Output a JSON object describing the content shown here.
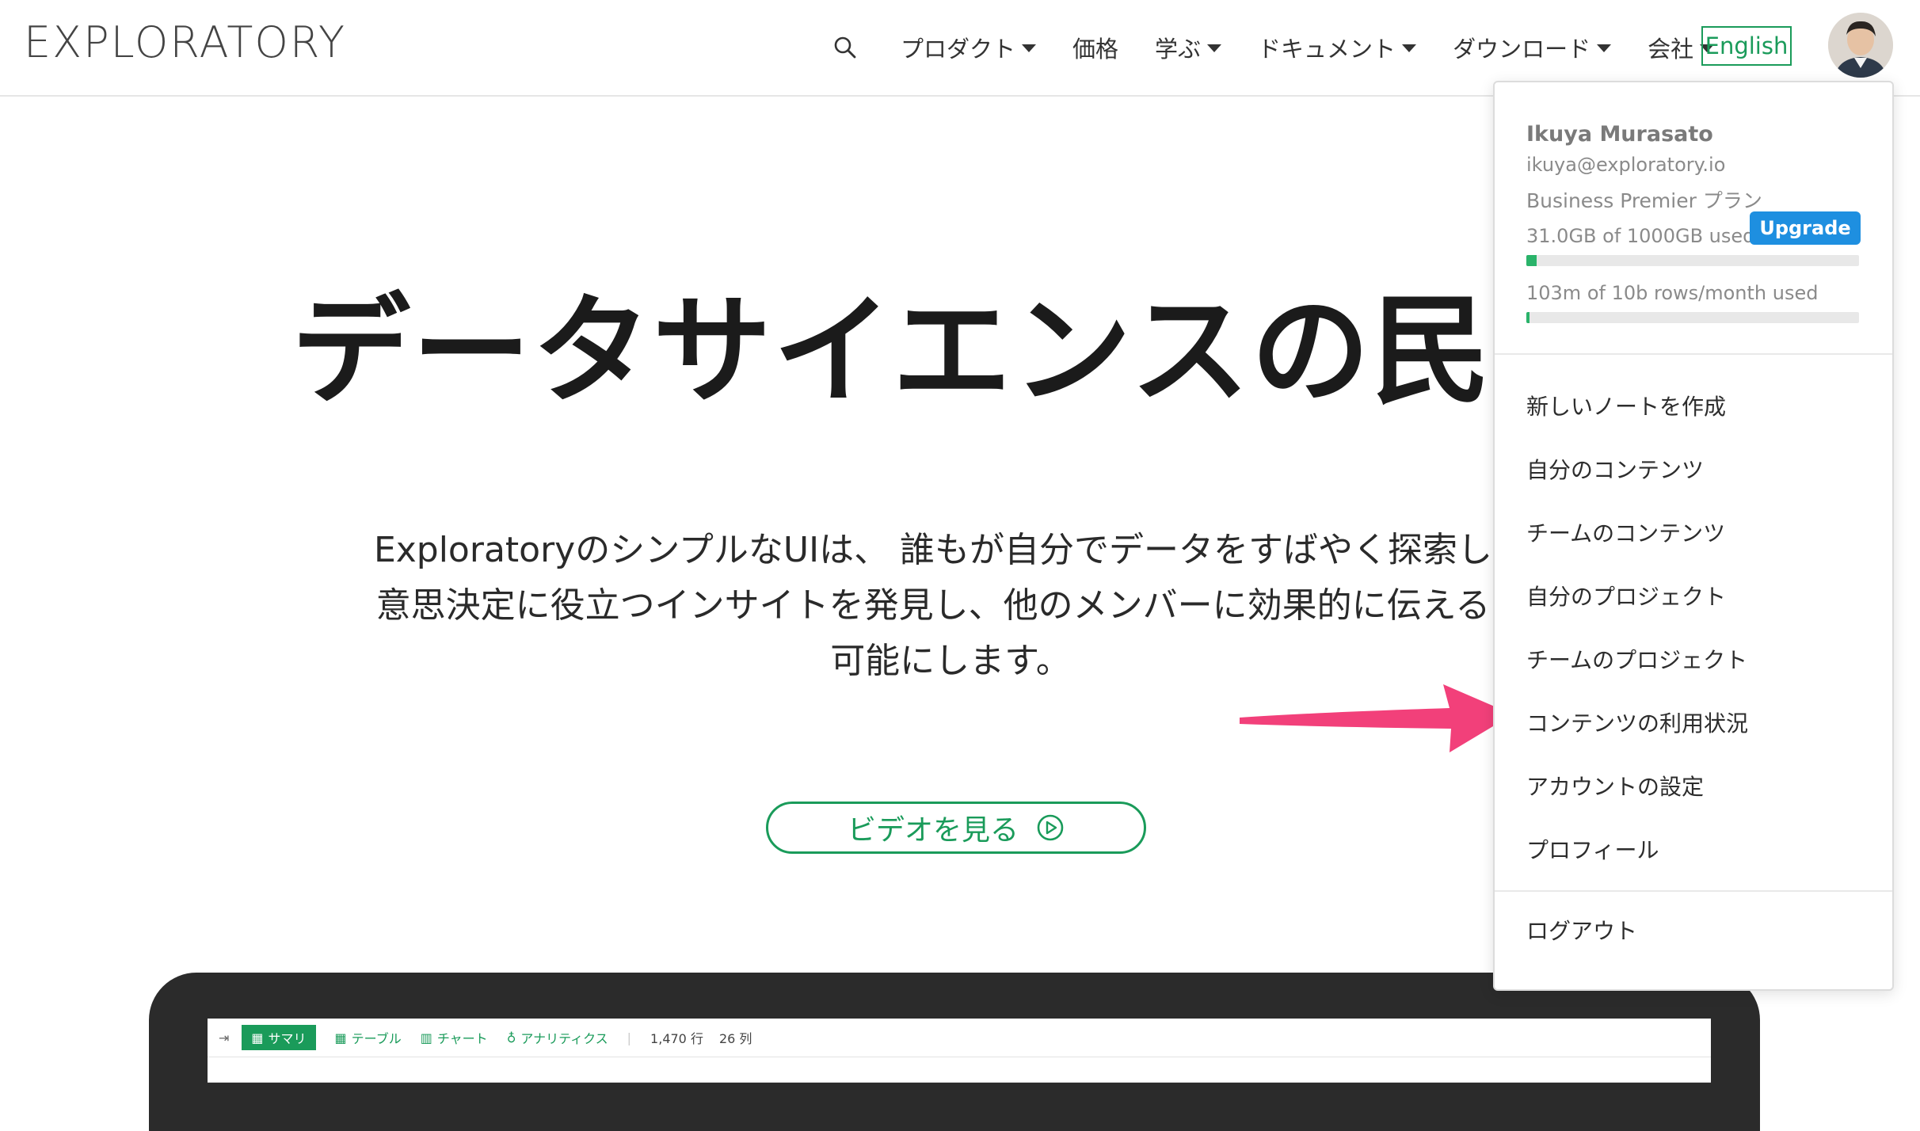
{
  "header": {
    "logo": "EXPLORATORY",
    "nav": [
      {
        "label": "プロダクト",
        "has_caret": true
      },
      {
        "label": "価格",
        "has_caret": false
      },
      {
        "label": "学ぶ",
        "has_caret": true
      },
      {
        "label": "ドキュメント",
        "has_caret": true
      },
      {
        "label": "ダウンロード",
        "has_caret": true
      },
      {
        "label": "会社",
        "has_caret": true
      }
    ],
    "lang_button": "English",
    "search_icon": "search-icon"
  },
  "hero": {
    "title": "データサイエンスの民主",
    "description_lines": [
      "ExploratoryのシンプルなUIは、 誰もが自分でデータをすばやく探索し、",
      "意思決定に役立つインサイトを発見し、他のメンバーに効果的に伝えるこ",
      "可能にします。"
    ],
    "video_button": "ビデオを見る"
  },
  "app_preview": {
    "tabs": [
      "サマリ",
      "テーブル",
      "チャート",
      "アナリティクス"
    ],
    "rows": "1,470 行",
    "cols": "26 列"
  },
  "account_menu": {
    "name": "Ikuya Murasato",
    "email": "ikuya@exploratory.io",
    "plan": "Business Premier プラン",
    "storage_text": "31.0GB of 1000GB used",
    "storage_fraction": 0.031,
    "rows_text": "103m of 10b rows/month used",
    "rows_fraction": 0.0103,
    "upgrade_label": "Upgrade",
    "items": [
      "新しいノートを作成",
      "自分のコンテンツ",
      "チームのコンテンツ",
      "自分のプロジェクト",
      "チームのプロジェクト",
      "コンテンツの利用状況",
      "アカウントの設定",
      "プロフィール"
    ],
    "logout": "ログアウト"
  },
  "colors": {
    "brand_green": "#1a9b5a",
    "upgrade_blue": "#1e8fe0",
    "arrow_pink": "#f2407a"
  }
}
